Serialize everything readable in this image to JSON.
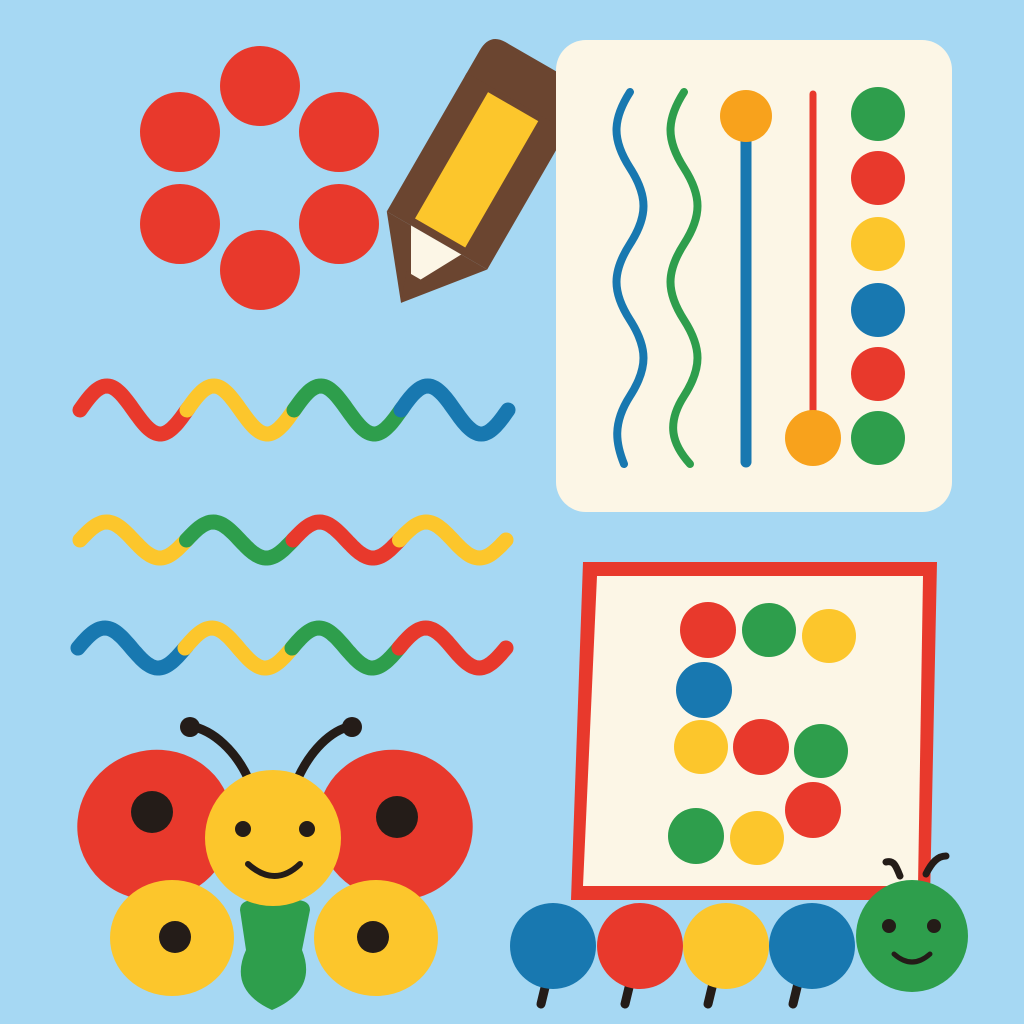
{
  "background": "#a6d8f3",
  "palette": {
    "red": "#e8392c",
    "yellow": "#fcc62c",
    "green": "#2e9e4c",
    "blue": "#1878b0",
    "orange": "#f8a21c",
    "brown": "#6b4530",
    "cream": "#fcf6e6",
    "dark": "#241c18"
  },
  "elements": {
    "dot_flower": {
      "dot_count": 6,
      "color": "red"
    },
    "pencil": {
      "body": "yellow",
      "eraser": "brown",
      "tip": "brown"
    },
    "wavy_lines": [
      {
        "colors": [
          "red",
          "yellow",
          "green",
          "blue"
        ]
      },
      {
        "colors": [
          "yellow",
          "green",
          "red",
          "yellow"
        ]
      },
      {
        "colors": [
          "blue",
          "yellow",
          "green",
          "red"
        ]
      }
    ],
    "stripes_card": {
      "wavy_strokes": [
        "blue",
        "green"
      ],
      "bead_rod": {
        "rod": "blue",
        "bead": "orange"
      },
      "red_rod": {
        "rod": "red",
        "bead": "orange"
      },
      "dot_column": [
        "green",
        "red",
        "yellow",
        "blue",
        "red",
        "green"
      ]
    },
    "dot_board": {
      "border": "red",
      "dots": [
        "red",
        "green",
        "yellow",
        "blue",
        "yellow",
        "red",
        "green",
        "red",
        "green",
        "yellow"
      ]
    },
    "butterfly": {
      "upper_wings": "red",
      "lower_wings": "yellow",
      "head": "yellow",
      "body": "green",
      "expression": "smile"
    },
    "caterpillar": {
      "segments": [
        "blue",
        "red",
        "yellow",
        "blue"
      ],
      "head": "green",
      "expression": "smile"
    }
  }
}
